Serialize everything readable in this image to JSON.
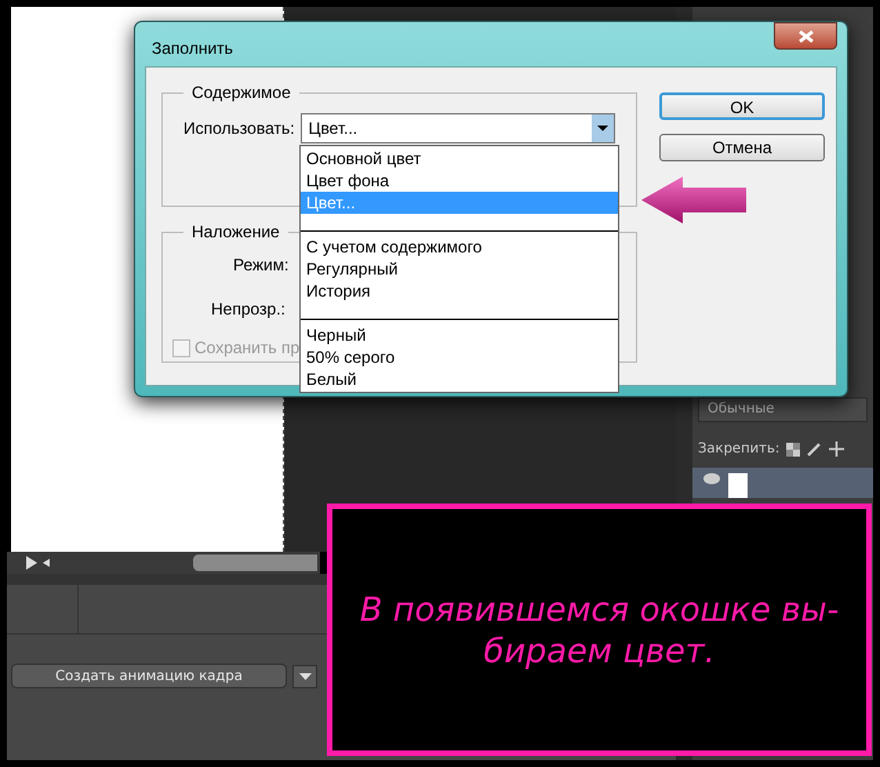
{
  "dialog": {
    "title": "Заполнить",
    "content_group": {
      "legend": "Содержимое",
      "use_label": "Использовать:",
      "use_value": "Цвет..."
    },
    "dropdown": {
      "expanded": true,
      "options": [
        {
          "kind": "option",
          "label": "Основной цвет",
          "selected": false
        },
        {
          "kind": "option",
          "label": "Цвет фона",
          "selected": false
        },
        {
          "kind": "option",
          "label": "Цвет...",
          "selected": true
        },
        {
          "kind": "separator"
        },
        {
          "kind": "option",
          "label": "С учетом содержимого",
          "selected": false
        },
        {
          "kind": "option",
          "label": "Регулярный",
          "selected": false
        },
        {
          "kind": "option",
          "label": "История",
          "selected": false
        },
        {
          "kind": "separator"
        },
        {
          "kind": "option",
          "label": "Черный",
          "selected": false
        },
        {
          "kind": "option",
          "label": "50% серого",
          "selected": false
        },
        {
          "kind": "option",
          "label": "Белый",
          "selected": false
        }
      ]
    },
    "blending_group": {
      "legend": "Наложение",
      "mode_label": "Режим:",
      "opacity_label": "Непрозр.:",
      "preserve": {
        "label": "Сохранить пр",
        "checked": false,
        "disabled": true
      }
    },
    "buttons": [
      {
        "label": "OK",
        "default": true
      },
      {
        "label": "Отмена",
        "default": false
      }
    ]
  },
  "layers_panel": {
    "blend_mode": "Обычные",
    "lock_label": "Закрепить:"
  },
  "timeline": {
    "create_button": "Создать анимацию кадра"
  },
  "annotation": {
    "lines": [
      "В появившемся окошке вы-",
      "бираем цвет."
    ]
  }
}
